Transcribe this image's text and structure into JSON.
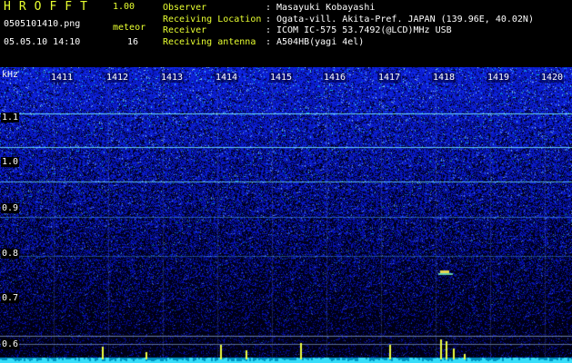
{
  "header": {
    "app_title": "HROFFT",
    "app_version": "1.00",
    "filename": "0505101410.png",
    "datetime": "05.05.10 14:10",
    "meteor_label": "meteor",
    "meteor_count": "16"
  },
  "info": [
    {
      "label": "Observer",
      "sep": ":",
      "value": "Masayuki Kobayashi"
    },
    {
      "label": "Receiving Location",
      "sep": ":",
      "value": "Ogata-vill. Akita-Pref. JAPAN (139.96E, 40.02N)"
    },
    {
      "label": "Receiver",
      "sep": ":",
      "value": "ICOM IC-575 53.7492(@LCD)MHz USB"
    },
    {
      "label": "Receiving antenna",
      "sep": ":",
      "value": "A504HB(yagi 4el)"
    }
  ],
  "axis": {
    "unit": "kHz",
    "freq_labels": [
      "1.1",
      "1.0",
      "0.9",
      "0.8",
      "0.7",
      "0.6"
    ],
    "time_labels": [
      "1411",
      "1412",
      "1413",
      "1414",
      "1415",
      "1416",
      "1417",
      "1418",
      "1419",
      "1420"
    ]
  },
  "colors": {
    "label_yellow": "#e8ff30",
    "background": "#000000",
    "noise_blue": "#1a35c8",
    "carrier_cyan": "#60f0ff",
    "meteor_yellow": "#ffff40"
  }
}
